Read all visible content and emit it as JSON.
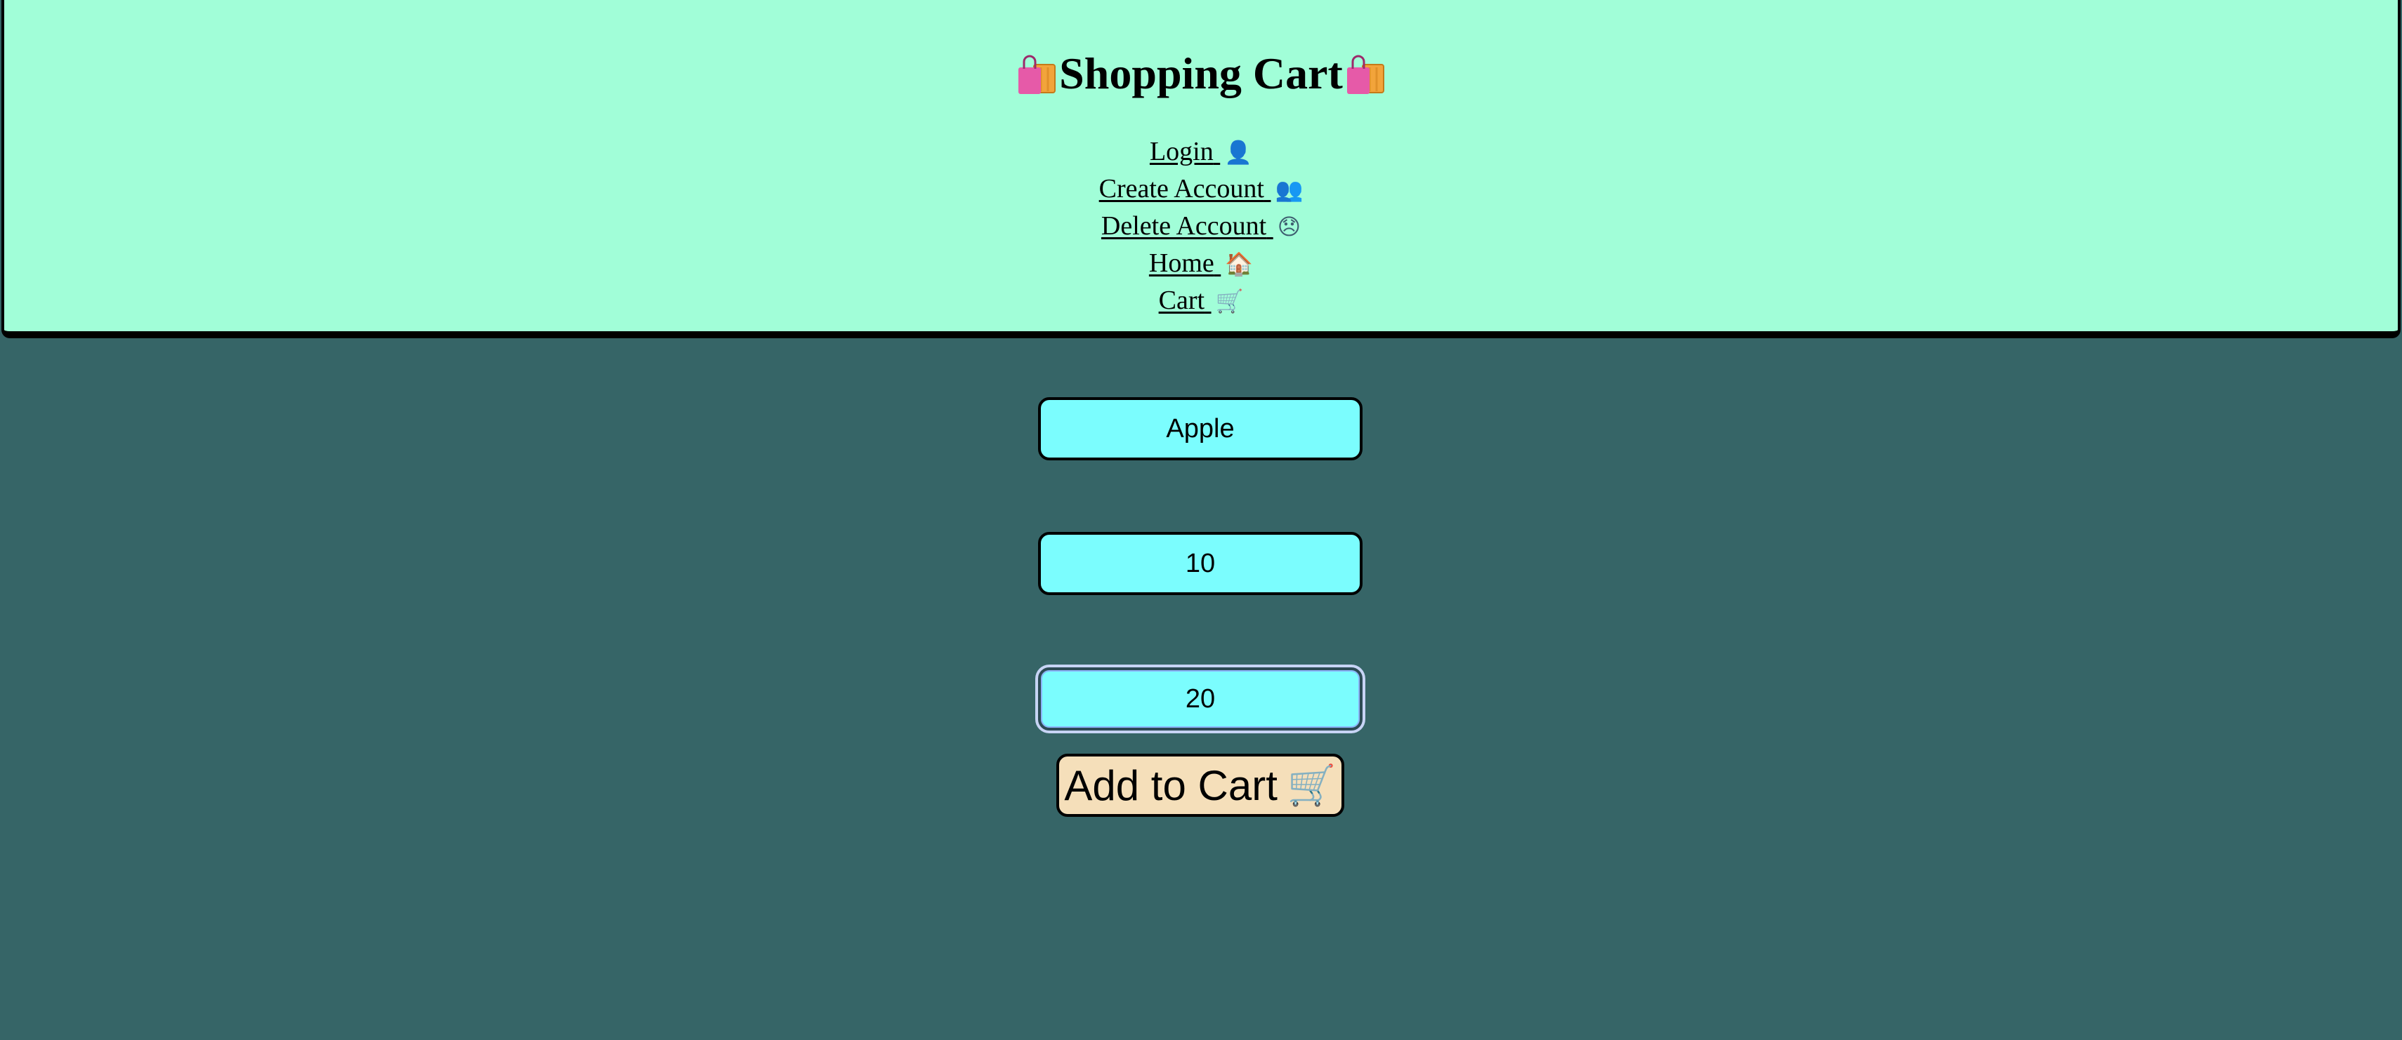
{
  "header": {
    "title": "Shopping Cart",
    "title_icon": "shopping-bags-icon",
    "nav": [
      {
        "label": "Login",
        "icon": "👤",
        "icon_name": "user-icon"
      },
      {
        "label": "Create Account",
        "icon": "👥",
        "icon_name": "users-icon"
      },
      {
        "label": "Delete Account",
        "icon": "😞",
        "icon_name": "sad-face-icon"
      },
      {
        "label": "Home",
        "icon": "🏠",
        "icon_name": "house-icon"
      },
      {
        "label": "Cart",
        "icon": "🛒",
        "icon_name": "cart-icon"
      }
    ]
  },
  "form": {
    "item_name_value": "Apple",
    "quantity_value": "10",
    "price_value": "20",
    "add_button_label": "Add to Cart",
    "add_button_icon": "🛒"
  },
  "colors": {
    "page_background": "#366567",
    "header_background": "#a1fed8",
    "input_background": "#7bfdfe",
    "button_background": "#f5dfba",
    "focus_ring": "#8ab4f8"
  }
}
